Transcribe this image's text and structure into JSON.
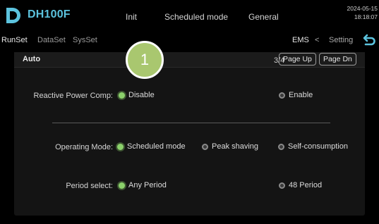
{
  "header": {
    "logo_letter": "D",
    "model": "DH100F",
    "nav": [
      "Init",
      "Scheduled mode",
      "General"
    ],
    "date": "2024-05-15",
    "time": "18:18:07"
  },
  "subnav": {
    "tabs": [
      "RunSet",
      "DataSet",
      "SysSet"
    ],
    "ems": "EMS",
    "separator": "<",
    "setting": "Setting"
  },
  "panel": {
    "title": "Auto",
    "page_count": "3/4",
    "page_up": "Page Up",
    "page_dn": "Page Dn"
  },
  "reactive": {
    "label": "Reactive Power Comp:",
    "options": [
      {
        "label": "Disable",
        "selected": true
      },
      {
        "label": "Enable",
        "selected": false
      }
    ]
  },
  "operating": {
    "label": "Operating Mode:",
    "options": [
      {
        "label": "Scheduled mode",
        "selected": true
      },
      {
        "label": "Peak shaving",
        "selected": false
      },
      {
        "label": "Self-consumption",
        "selected": false
      }
    ]
  },
  "period": {
    "label": "Period select:",
    "options": [
      {
        "label": "Any Period",
        "selected": true
      },
      {
        "label": "48 Period",
        "selected": false
      }
    ]
  },
  "badge": {
    "number": "1"
  },
  "colors": {
    "brand": "#5cc3de",
    "radio_on": "#8bd16b",
    "badge": "#a9c76f",
    "panel": "#141414"
  }
}
